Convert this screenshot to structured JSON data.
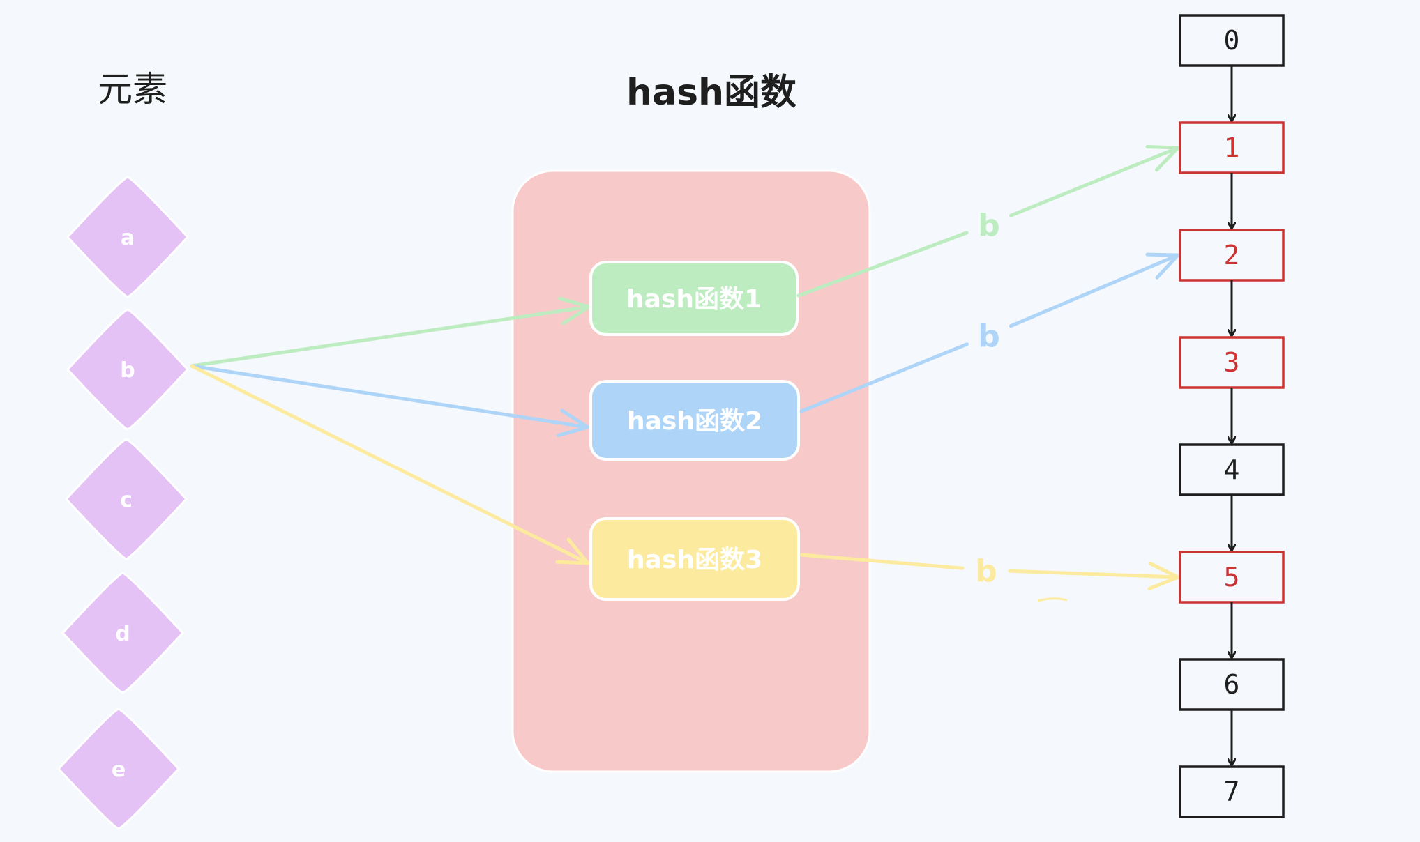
{
  "titles": {
    "elements": "元素",
    "hash_functions": "hash函数"
  },
  "elements": [
    {
      "id": "a",
      "label": "a"
    },
    {
      "id": "b",
      "label": "b"
    },
    {
      "id": "c",
      "label": "c"
    },
    {
      "id": "d",
      "label": "d"
    },
    {
      "id": "e",
      "label": "e"
    }
  ],
  "hash_functions": [
    {
      "label": "hash函数1",
      "fill": "#bdecc1",
      "target": "1"
    },
    {
      "label": "hash函数2",
      "fill": "#aed5f8",
      "target": "2"
    },
    {
      "label": "hash函数3",
      "fill": "#fceb9e",
      "target": "5"
    }
  ],
  "mapping": {
    "source_element": "b",
    "edge_label": "b"
  },
  "slots": [
    {
      "label": "0",
      "set": false
    },
    {
      "label": "1",
      "set": true
    },
    {
      "label": "2",
      "set": true
    },
    {
      "label": "3",
      "set": true
    },
    {
      "label": "4",
      "set": false
    },
    {
      "label": "5",
      "set": true
    },
    {
      "label": "6",
      "set": false
    },
    {
      "label": "7",
      "set": false
    }
  ],
  "colors": {
    "background": "#f5f8fc",
    "element_fill": "#e5c2f5",
    "container_fill": "#f7c9c8",
    "slot_set": "#cc3333",
    "slot_unset": "#1e1e1e",
    "arrow_green": "#bdecc1",
    "arrow_blue": "#aed5f8",
    "arrow_yellow": "#fceb9e"
  }
}
